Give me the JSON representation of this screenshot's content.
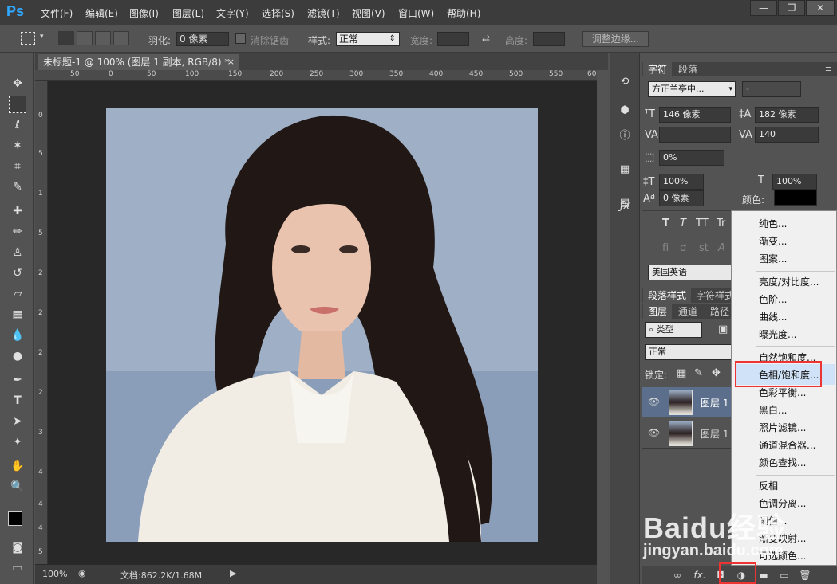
{
  "app": {
    "logo": "Ps"
  },
  "menu": [
    "文件(F)",
    "编辑(E)",
    "图像(I)",
    "图层(L)",
    "文字(Y)",
    "选择(S)",
    "滤镜(T)",
    "视图(V)",
    "窗口(W)",
    "帮助(H)"
  ],
  "window_controls": [
    "—",
    "❐",
    "✕"
  ],
  "options": {
    "feather_label": "羽化:",
    "feather_value": "0 像素",
    "antialias_label": "消除锯齿",
    "style_label": "样式:",
    "style_value": "正常",
    "width_label": "宽度:",
    "height_label": "高度:",
    "refine_edge": "调整边缘..."
  },
  "document": {
    "tab_title": "未标题-1 @ 100% (图层 1 副本, RGB/8) *",
    "ruler_h": [
      "50",
      "0",
      "50",
      "100",
      "150",
      "200",
      "250",
      "300",
      "350",
      "400",
      "450",
      "500",
      "550",
      "60"
    ],
    "ruler_v": [
      "0",
      "5",
      "1",
      "5",
      "2",
      "2",
      "2",
      "2",
      "3",
      "4",
      "4",
      "4",
      "5"
    ],
    "zoom": "100%",
    "doc_info": "文档:862.2K/1.68M"
  },
  "character_panel": {
    "tabs": [
      "字符",
      "段落"
    ],
    "font_family": "方正兰亭中...",
    "font_style": "-",
    "font_size": "146 像素",
    "leading": "182 像素",
    "kerning": "",
    "tracking": "140",
    "vscale_pct": "0%",
    "vertical_scale": "100%",
    "horizontal_scale": "100%",
    "baseline": "0 像素",
    "color_label": "颜色:",
    "style_buttons": [
      "T",
      "T",
      "TT",
      "Tr"
    ],
    "opentype_buttons": [
      "fi",
      "ơ",
      "st",
      "A"
    ],
    "language": "美国英语"
  },
  "style_tabs": [
    "段落样式",
    "字符样式"
  ],
  "layers_panel": {
    "tabs": [
      "图层",
      "通道",
      "路径"
    ],
    "kind_filter": "类型",
    "blend_mode": "正常",
    "lock_label": "锁定:",
    "layers": [
      {
        "name": "图层 1",
        "selected": true
      },
      {
        "name": "图层 1",
        "selected": false
      }
    ],
    "bottom_icons": [
      "link-icon",
      "fx-icon",
      "mask-icon",
      "adjustment-icon",
      "folder-icon",
      "new-layer-icon",
      "trash-icon"
    ]
  },
  "adjustment_menu": {
    "groups": [
      [
        "纯色...",
        "渐变...",
        "图案..."
      ],
      [
        "亮度/对比度...",
        "色阶...",
        "曲线...",
        "曝光度..."
      ],
      [
        "自然饱和度...",
        "色相/饱和度...",
        "色彩平衡...",
        "黑白...",
        "照片滤镜...",
        "通道混合器...",
        "颜色查找..."
      ],
      [
        "反相",
        "色调分离...",
        "阈值...",
        "渐变映射...",
        "可选颜色..."
      ]
    ],
    "highlighted": "色相/饱和度..."
  },
  "watermark": {
    "brand": "Baidu经验",
    "url": "jingyan.baidu.com"
  },
  "colors": {
    "accent_red": "#ee3333",
    "highlight": "#cfe2f7",
    "ps_blue": "#31a8ff"
  }
}
